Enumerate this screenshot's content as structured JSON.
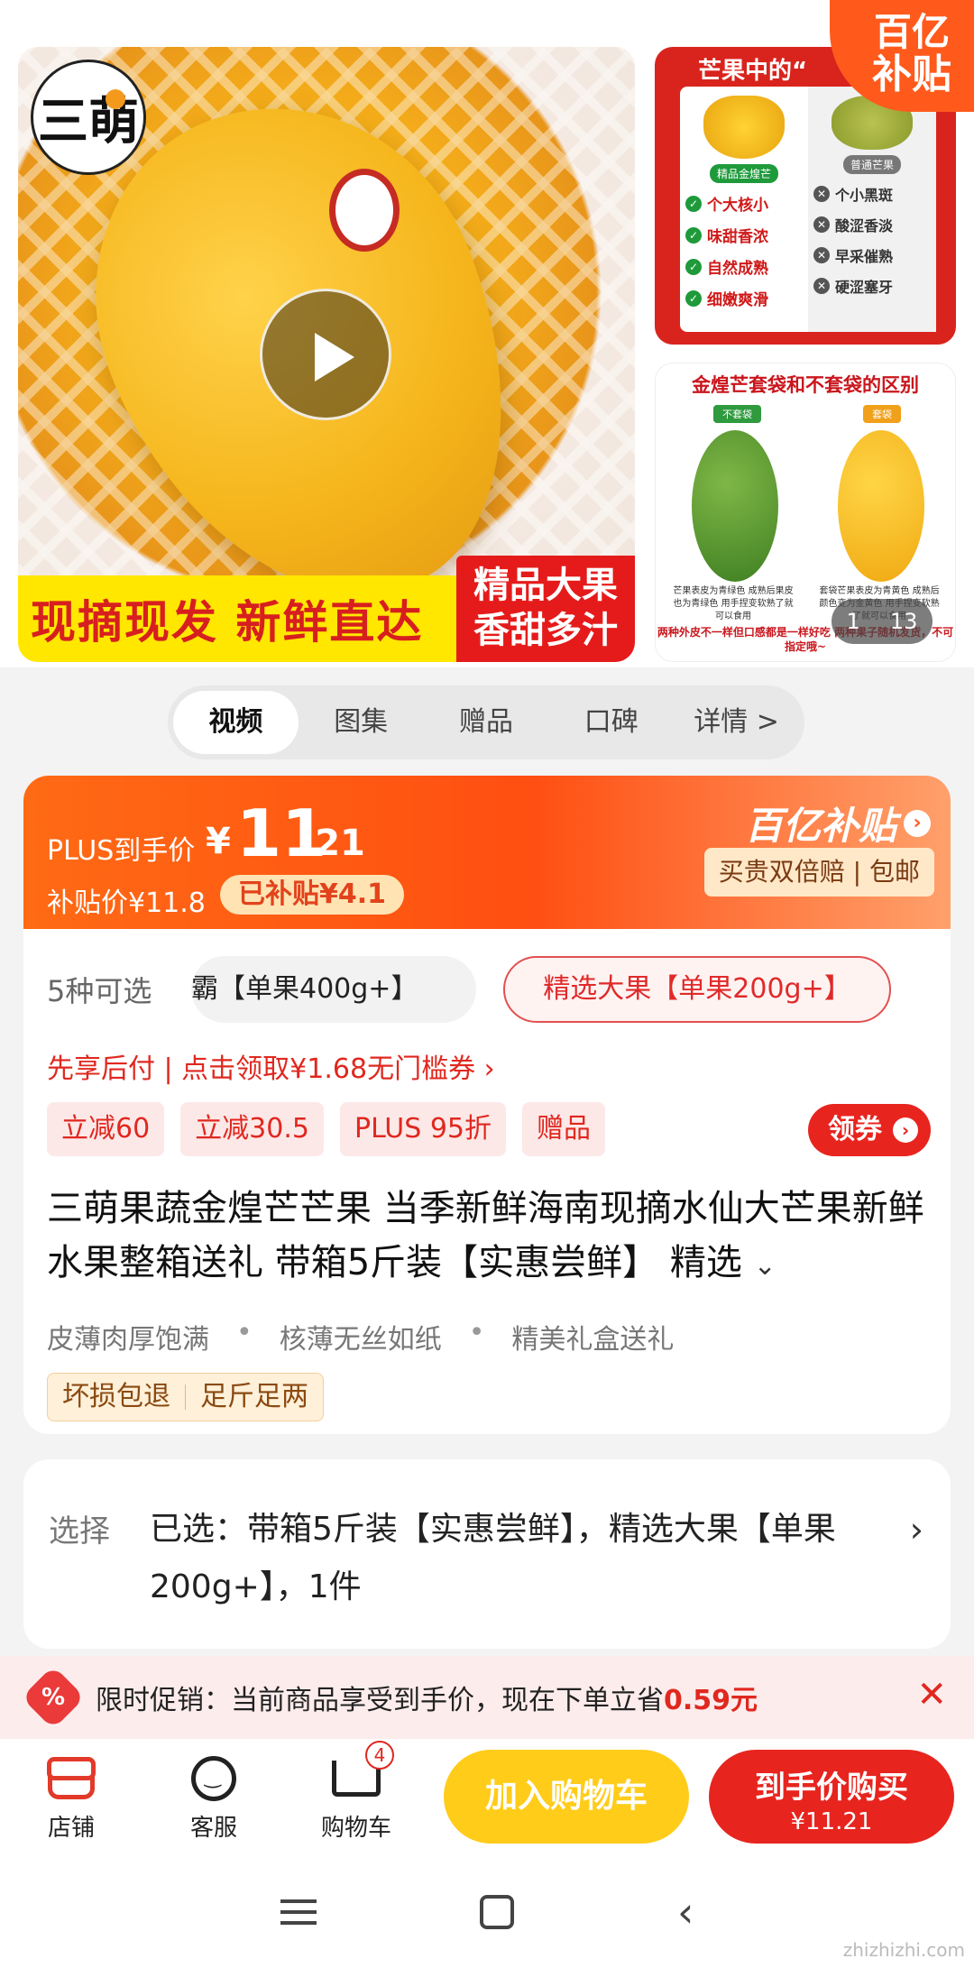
{
  "gallery": {
    "logo_text": "三萌",
    "main_banner_left": "现摘现发 新鲜直达",
    "main_banner_right_l1": "精品大果",
    "main_banner_right_l2": "香甜多汁",
    "thumb1_title": "芒果中的“",
    "thumb1_left_tag": "精品金煌芒",
    "thumb1_right_tag": "普通芒果",
    "thumb1_left_features": [
      "个大核小",
      "味甜香浓",
      "自然成熟",
      "细嫩爽滑"
    ],
    "thumb1_right_features": [
      "个小黑斑",
      "酸涩香淡",
      "早采催熟",
      "硬涩塞牙"
    ],
    "subsidy_badge_l1": "百亿",
    "subsidy_badge_l2": "补贴",
    "thumb2_title": "金煌芒套袋和不套袋的区别",
    "thumb2_tag_left": "不套袋",
    "thumb2_tag_right": "套袋",
    "thumb2_desc_left": "芒果表皮为青绿色 成熟后果皮也为青绿色 用手捏变软熟了就可以食用",
    "thumb2_desc_right": "套袋芒果表皮为青黄色 成熟后颜色变为金黄色 用手捏变软熟了就可以食用",
    "thumb2_footer": "两种外皮不一样但口感都是一样好吃 两种果子随机发货，不可指定哦~",
    "pager_current": "1",
    "pager_total": "13"
  },
  "tabs": [
    "视频",
    "图集",
    "赠品",
    "口碑",
    "详情 >"
  ],
  "price": {
    "plus_label": "PLUS到手价",
    "currency": "¥",
    "integer": "11",
    "decimal": ".21",
    "subsidy_price": "补贴价¥11.8",
    "saved": "已补贴¥4.1",
    "subsidy_logo": "百亿补贴",
    "guarantee": "买贵双倍赔 | 包邮"
  },
  "variants": {
    "count": "5种可选",
    "chip1": "霸【单果400g+】",
    "chip2": "精选大果【单果200g+】"
  },
  "pay_later": "先享后付 | 点击领取¥1.68无门槛券 ›",
  "promos": [
    "立减60",
    "立减30.5",
    "PLUS 95折",
    "赠品"
  ],
  "coupon_button": "领券",
  "product_title": "三萌果蔬金煌芒芒果 当季新鲜海南现摘水仙大芒果新鲜水果整箱送礼 带箱5斤装【实惠尝鲜】 精选",
  "selling_points": [
    "皮薄肉厚饱满",
    "核薄无丝如纸",
    "精美礼盒送礼"
  ],
  "assurance": [
    "坏损包退",
    "足斤足两"
  ],
  "selection": {
    "label": "选择",
    "text": "已选：带箱5斤装【实惠尝鲜】，精选大果【单果200g+】，1件"
  },
  "promo_strip": {
    "icon": "%",
    "text": "限时促销：当前商品享受到手价，现在下单立省",
    "value": "0.59元"
  },
  "action_bar": {
    "store": "店铺",
    "service": "客服",
    "cart": "购物车",
    "cart_count": "4",
    "add_to_cart": "加入购物车",
    "buy_l1": "到手价购买",
    "buy_l2": "¥11.21"
  },
  "watermark": "zhizhizhi.com"
}
